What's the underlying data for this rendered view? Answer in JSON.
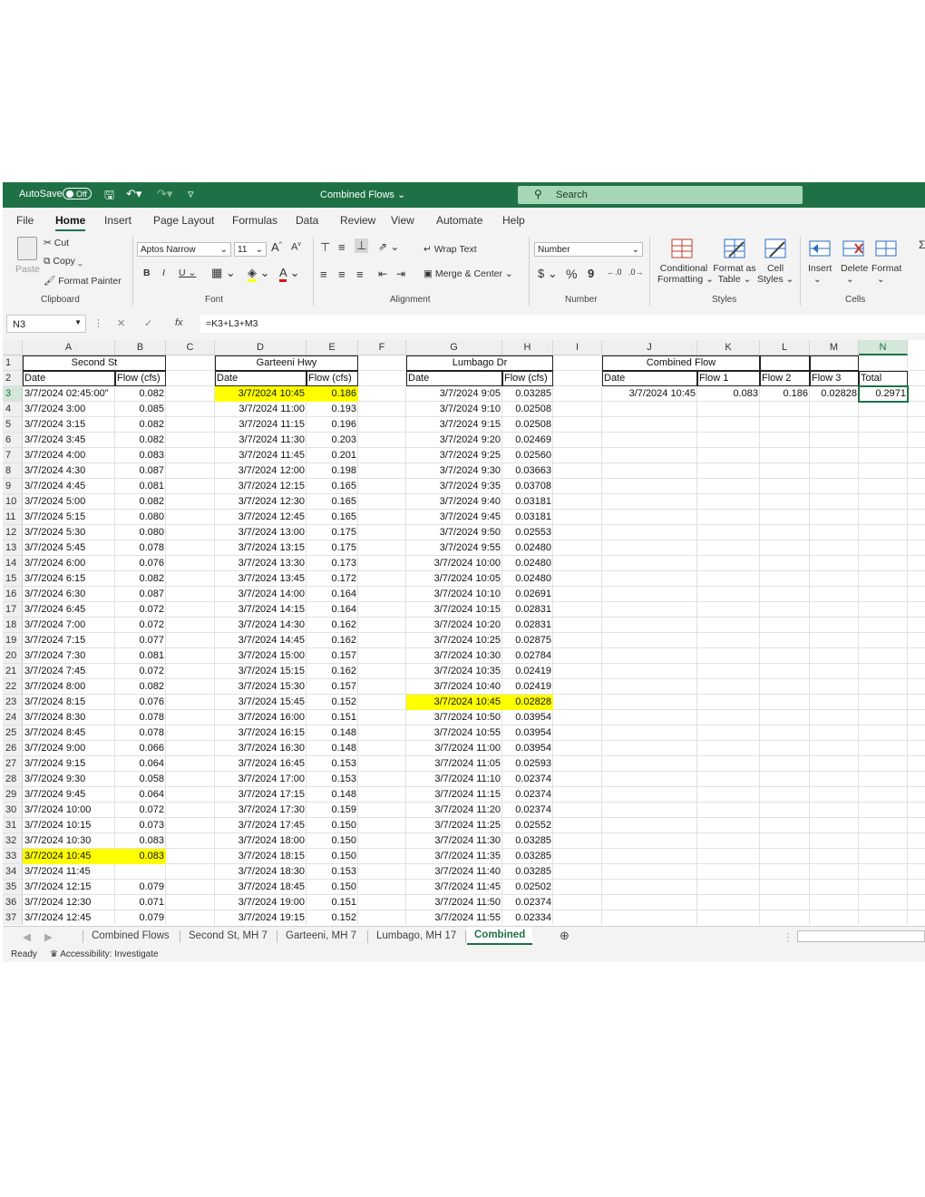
{
  "titlebar": {
    "autosave_label": "AutoSave",
    "autosave_state": "Off",
    "document_title": "Combined Flows",
    "search_placeholder": "Search",
    "accent_color": "#1e7145"
  },
  "menu_tabs": [
    "File",
    "Home",
    "Insert",
    "Page Layout",
    "Formulas",
    "Data",
    "Review",
    "View",
    "Automate",
    "Help"
  ],
  "active_menu_tab": "Home",
  "ribbon": {
    "clipboard": {
      "paste": "Paste",
      "cut": "Cut",
      "copy": "Copy",
      "format_painter": "Format Painter",
      "group": "Clipboard"
    },
    "font": {
      "name": "Aptos Narrow",
      "size": "11",
      "bold": "B",
      "italic": "I",
      "underline": "U",
      "group": "Font"
    },
    "alignment": {
      "wrap_text": "Wrap Text",
      "merge_center": "Merge & Center",
      "group": "Alignment"
    },
    "number": {
      "format": "Number",
      "currency": "$",
      "percent": "%",
      "comma": "9",
      "group": "Number"
    },
    "styles": {
      "conditional": "Conditional",
      "formatting": "Formatting",
      "format_as": "Format as",
      "table": "Table",
      "cell": "Cell",
      "cell_styles": "Styles",
      "group": "Styles"
    },
    "cells": {
      "insert": "Insert",
      "delete": "Delete",
      "format": "Format",
      "group": "Cells"
    }
  },
  "formula_bar": {
    "name_box": "N3",
    "fx": "fx",
    "formula": "=K3+L3+M3"
  },
  "sheet": {
    "columns": [
      "A",
      "B",
      "C",
      "D",
      "E",
      "F",
      "G",
      "H",
      "I",
      "J",
      "K",
      "L",
      "M",
      "N"
    ],
    "selected_column": "N",
    "row_numbers": [
      "1",
      "2",
      "3",
      "4",
      "5",
      "6",
      "7",
      "8",
      "9",
      "10",
      "11",
      "12",
      "13",
      "14",
      "15",
      "16",
      "17",
      "18",
      "19",
      "20",
      "21",
      "22",
      "23",
      "24",
      "25",
      "26",
      "27",
      "28",
      "29",
      "30",
      "31",
      "32",
      "33",
      "34",
      "35",
      "36",
      "37"
    ],
    "headers": {
      "second_st": "Second St",
      "garteeni": "Garteeni Hwy",
      "lumbago": "Lumbago Dr",
      "combined": "Combined Flow",
      "date": "Date",
      "flow_cfs": "Flow (cfs)",
      "flow1": "Flow 1",
      "flow2": "Flow 2",
      "flow3": "Flow 3",
      "total": "Total"
    },
    "second_st": {
      "dates": [
        "3/7/2024 02:45:00\"",
        "3/7/2024 3:00",
        "3/7/2024 3:15",
        "3/7/2024 3:45",
        "3/7/2024 4:00",
        "3/7/2024 4:30",
        "3/7/2024 4:45",
        "3/7/2024 5:00",
        "3/7/2024 5:15",
        "3/7/2024 5:30",
        "3/7/2024 5:45",
        "3/7/2024 6:00",
        "3/7/2024 6:15",
        "3/7/2024 6:30",
        "3/7/2024 6:45",
        "3/7/2024 7:00",
        "3/7/2024 7:15",
        "3/7/2024 7:30",
        "3/7/2024 7:45",
        "3/7/2024 8:00",
        "3/7/2024 8:15",
        "3/7/2024 8:30",
        "3/7/2024 8:45",
        "3/7/2024 9:00",
        "3/7/2024 9:15",
        "3/7/2024 9:30",
        "3/7/2024 9:45",
        "3/7/2024 10:00",
        "3/7/2024 10:15",
        "3/7/2024 10:30",
        "3/7/2024 10:45",
        "3/7/2024 11:45",
        "3/7/2024 12:15",
        "3/7/2024 12:30",
        "3/7/2024 12:45"
      ],
      "flows": [
        "0.082",
        "0.085",
        "0.082",
        "0.082",
        "0.083",
        "0.087",
        "0.081",
        "0.082",
        "0.080",
        "0.080",
        "0.078",
        "0.076",
        "0.082",
        "0.087",
        "0.072",
        "0.072",
        "0.077",
        "0.081",
        "0.072",
        "0.082",
        "0.076",
        "0.078",
        "0.078",
        "0.066",
        "0.064",
        "0.058",
        "0.064",
        "0.072",
        "0.073",
        "0.083",
        "0.083",
        "",
        "0.079",
        "0.071",
        "0.079"
      ]
    },
    "garteeni": {
      "dates": [
        "3/7/2024 10:45",
        "3/7/2024 11:00",
        "3/7/2024 11:15",
        "3/7/2024 11:30",
        "3/7/2024 11:45",
        "3/7/2024 12:00",
        "3/7/2024 12:15",
        "3/7/2024 12:30",
        "3/7/2024 12:45",
        "3/7/2024 13:00",
        "3/7/2024 13:15",
        "3/7/2024 13:30",
        "3/7/2024 13:45",
        "3/7/2024 14:00",
        "3/7/2024 14:15",
        "3/7/2024 14:30",
        "3/7/2024 14:45",
        "3/7/2024 15:00",
        "3/7/2024 15:15",
        "3/7/2024 15:30",
        "3/7/2024 15:45",
        "3/7/2024 16:00",
        "3/7/2024 16:15",
        "3/7/2024 16:30",
        "3/7/2024 16:45",
        "3/7/2024 17:00",
        "3/7/2024 17:15",
        "3/7/2024 17:30",
        "3/7/2024 17:45",
        "3/7/2024 18:00",
        "3/7/2024 18:15",
        "3/7/2024 18:30",
        "3/7/2024 18:45",
        "3/7/2024 19:00",
        "3/7/2024 19:15"
      ],
      "flows": [
        "0.186",
        "0.193",
        "0.196",
        "0.203",
        "0.201",
        "0.198",
        "0.165",
        "0.165",
        "0.165",
        "0.175",
        "0.175",
        "0.173",
        "0.172",
        "0.164",
        "0.164",
        "0.162",
        "0.162",
        "0.157",
        "0.162",
        "0.157",
        "0.152",
        "0.151",
        "0.148",
        "0.148",
        "0.153",
        "0.153",
        "0.148",
        "0.159",
        "0.150",
        "0.150",
        "0.150",
        "0.153",
        "0.150",
        "0.151",
        "0.152"
      ]
    },
    "lumbago": {
      "dates": [
        "3/7/2024 9:05",
        "3/7/2024 9:10",
        "3/7/2024 9:15",
        "3/7/2024 9:20",
        "3/7/2024 9:25",
        "3/7/2024 9:30",
        "3/7/2024 9:35",
        "3/7/2024 9:40",
        "3/7/2024 9:45",
        "3/7/2024 9:50",
        "3/7/2024 9:55",
        "3/7/2024 10:00",
        "3/7/2024 10:05",
        "3/7/2024 10:10",
        "3/7/2024 10:15",
        "3/7/2024 10:20",
        "3/7/2024 10:25",
        "3/7/2024 10:30",
        "3/7/2024 10:35",
        "3/7/2024 10:40",
        "3/7/2024 10:45",
        "3/7/2024 10:50",
        "3/7/2024 10:55",
        "3/7/2024 11:00",
        "3/7/2024 11:05",
        "3/7/2024 11:10",
        "3/7/2024 11:15",
        "3/7/2024 11:20",
        "3/7/2024 11:25",
        "3/7/2024 11:30",
        "3/7/2024 11:35",
        "3/7/2024 11:40",
        "3/7/2024 11:45",
        "3/7/2024 11:50",
        "3/7/2024 11:55"
      ],
      "flows": [
        "0.03285",
        "0.02508",
        "0.02508",
        "0.02469",
        "0.02560",
        "0.03663",
        "0.03708",
        "0.03181",
        "0.03181",
        "0.02553",
        "0.02480",
        "0.02480",
        "0.02480",
        "0.02691",
        "0.02831",
        "0.02831",
        "0.02875",
        "0.02784",
        "0.02419",
        "0.02419",
        "0.02828",
        "0.03954",
        "0.03954",
        "0.03954",
        "0.02593",
        "0.02374",
        "0.02374",
        "0.02374",
        "0.02552",
        "0.03285",
        "0.03285",
        "0.03285",
        "0.02502",
        "0.02374",
        "0.02334"
      ]
    },
    "combined": {
      "date": "3/7/2024 10:45",
      "flow1": "0.083",
      "flow2": "0.186",
      "flow3": "0.02828",
      "total": "0.2971"
    },
    "highlight_color": "#ffff00"
  },
  "sheet_tabs": [
    "Combined Flows",
    "Second St, MH 7",
    "Garteeni, MH 7",
    "Lumbago, MH 17",
    "Combined"
  ],
  "active_sheet": "Combined",
  "status": {
    "ready": "Ready",
    "accessibility": "Accessibility: Investigate"
  }
}
